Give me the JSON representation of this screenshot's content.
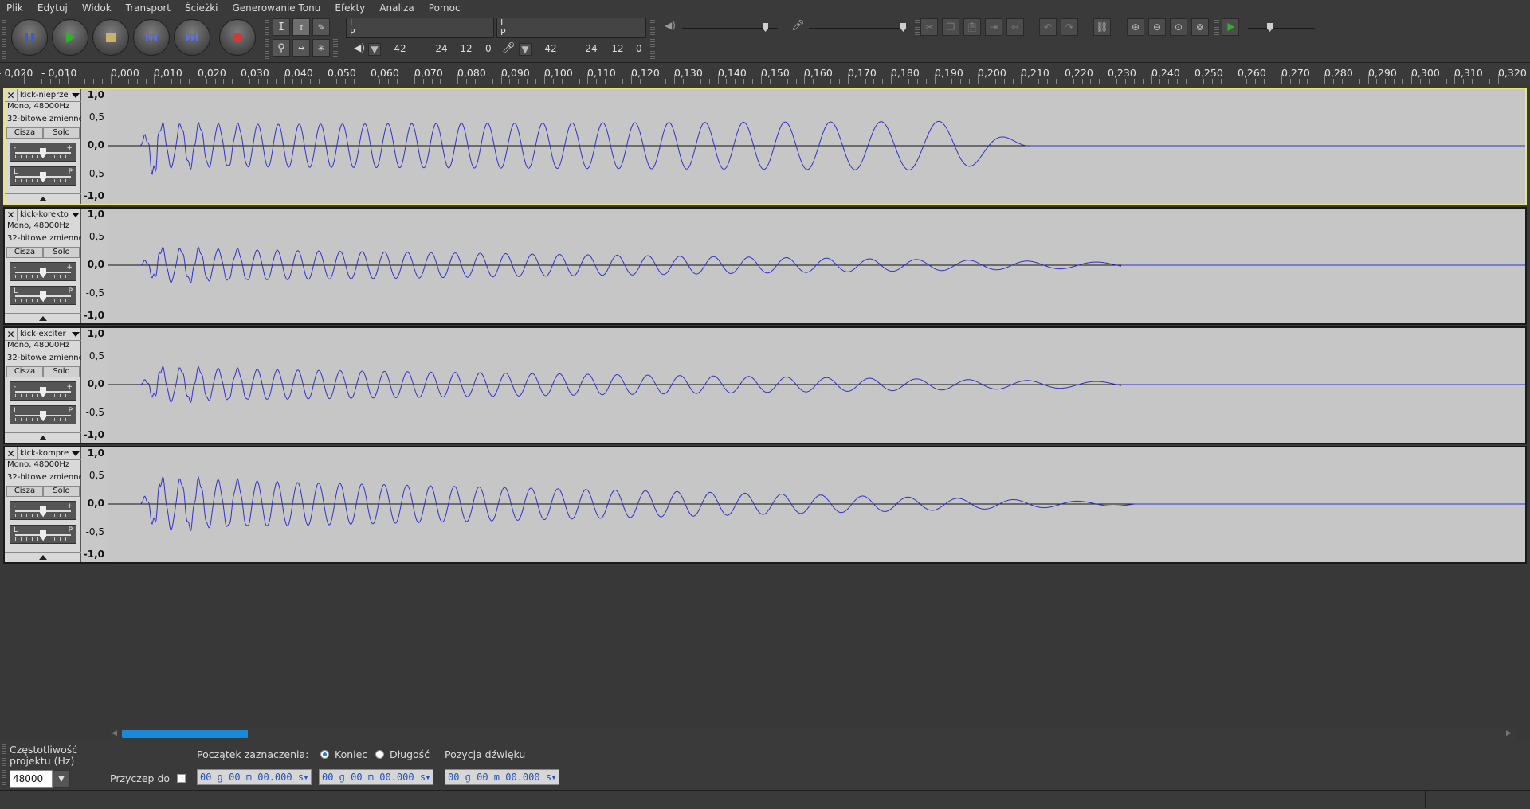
{
  "menu": [
    "Plik",
    "Edytuj",
    "Widok",
    "Transport",
    "Ścieżki",
    "Generowanie Tonu",
    "Efekty",
    "Analiza",
    "Pomoc"
  ],
  "meters": {
    "record_lr": [
      "L",
      "P"
    ],
    "play_lr": [
      "L",
      "P"
    ],
    "record_scale": [
      "-42",
      "-24",
      "-12",
      "0"
    ],
    "play_scale": [
      "-42",
      "-24",
      "-12",
      "0"
    ]
  },
  "ruler": {
    "labels": [
      "- 0,020",
      "- 0,010",
      "0,000",
      "0,010",
      "0,020",
      "0,030",
      "0,040",
      "0,050",
      "0,060",
      "0,070",
      "0,080",
      "0,090",
      "0,100",
      "0,110",
      "0,120",
      "0,130",
      "0,140",
      "0,150",
      "0,160",
      "0,170",
      "0,180",
      "0,190",
      "0,200",
      "0,210",
      "0,220",
      "0,230",
      "0,240",
      "0,250",
      "0,260",
      "0,270",
      "0,280",
      "0,290",
      "0,300",
      "0,310",
      "0,320"
    ]
  },
  "track_common": {
    "info1": "Mono, 48000Hz",
    "info2": "32-bitowe zmienne",
    "mute": "Cisza",
    "solo": "Solo",
    "gain_minus": "-",
    "gain_plus": "+",
    "pan_left": "L",
    "pan_right": "P",
    "scale": [
      "1,0",
      "0,5",
      "0,0",
      "-0,5",
      "-1,0"
    ]
  },
  "tracks": [
    {
      "name": "kick-nieprze",
      "selected": true,
      "amp": 0.92,
      "end": 0.211
    },
    {
      "name": "kick-korekto",
      "selected": false,
      "amp": 0.45,
      "end": 0.232
    },
    {
      "name": "kick-exciter",
      "selected": false,
      "amp": 0.45,
      "end": 0.232
    },
    {
      "name": "kick-kompre",
      "selected": false,
      "amp": 0.72,
      "end": 0.235
    }
  ],
  "selection": {
    "rate_label_1": "Częstotliwość",
    "rate_label_2": "projektu (Hz)",
    "rate_value": "48000",
    "snap_label": "Przyczep do",
    "sel_start_label": "Początek zaznaczenia:",
    "end_label": "Koniec",
    "length_label": "Długość",
    "pos_label": "Pozycja dźwięku",
    "time1": "00 g 00 m 00.000 s",
    "time2": "00 g 00 m 00.000 s",
    "time3": "00 g 00 m 00.000 s"
  },
  "colors": {
    "wave": "#3232c8",
    "selected_border": "#e6e67a",
    "scroll_thumb": "#1a8ad8"
  }
}
